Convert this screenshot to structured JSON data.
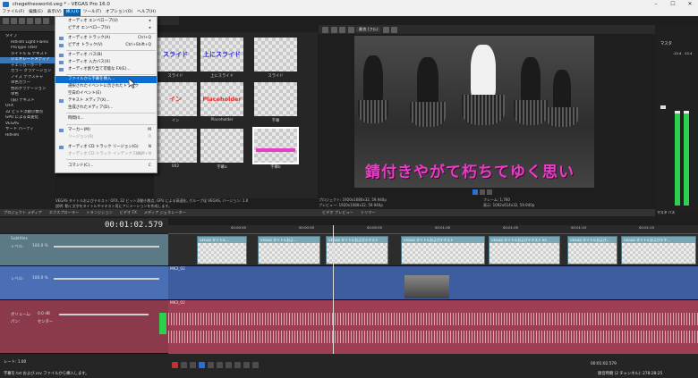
{
  "window": {
    "title": "chegethesworld.veg * - VEGAS Pro 16.0",
    "min": "–",
    "max": "☐",
    "close": "✕"
  },
  "menubar": [
    "ファイル(F)",
    "編集(E)",
    "表示(V)",
    "挿入(I)",
    "ツール(T)",
    "オプション(O)",
    "ヘルプ(H)"
  ],
  "menu_active": "挿入(I)",
  "insert_menu": [
    {
      "label": "オーディオ エンベロープ(U)",
      "shortcut": "",
      "state": "normal"
    },
    {
      "label": "ビデオ エンベロープ(V)",
      "shortcut": "",
      "state": "normal"
    },
    {
      "label": "オーディオ トラック(A)",
      "shortcut": "Ctrl+Q",
      "state": "normal"
    },
    {
      "label": "ビデオ トラック(V)",
      "shortcut": "Ctrl+Shift+Q",
      "state": "normal"
    },
    {
      "label": "オーディオ バス(B)",
      "shortcut": "",
      "state": "normal"
    },
    {
      "label": "オーディオ 入力バス(X)",
      "shortcut": "",
      "state": "normal"
    },
    {
      "label": "オーディオ割り当て可能な FX(E)...",
      "shortcut": "",
      "state": "normal"
    },
    {
      "label": "ファイルから字幕を挿入...",
      "shortcut": "",
      "state": "highlight"
    },
    {
      "label": "選択されたイベントに示されたトラック",
      "shortcut": "",
      "state": "normal"
    },
    {
      "label": "空白のイベント(E)",
      "shortcut": "",
      "state": "normal"
    },
    {
      "label": "テキスト メディア(X)...",
      "shortcut": "",
      "state": "normal"
    },
    {
      "label": "生成されたメディア(D)...",
      "shortcut": "",
      "state": "normal"
    },
    {
      "label": "時間(I)...",
      "shortcut": "",
      "state": "normal"
    },
    {
      "label": "マーカー(M)",
      "shortcut": "M",
      "state": "normal"
    },
    {
      "label": "リージョン(R)",
      "shortcut": "R",
      "state": "disabled"
    },
    {
      "label": "オーディオ CD トラック リージョン(G)",
      "shortcut": "N",
      "state": "normal"
    },
    {
      "label": "オーディオ CD トラック インデックス(X)",
      "shortcut": "Shift+N",
      "state": "disabled"
    },
    {
      "label": "コマンド(C)...",
      "shortcut": "C",
      "state": "normal"
    }
  ],
  "tree": [
    {
      "label": "タイプ",
      "level": 0
    },
    {
      "label": "HitFilm Light Flares",
      "level": 1
    },
    {
      "label": "ProType Titler",
      "level": 1
    },
    {
      "label": "タイトル & テキスト",
      "level": 1
    },
    {
      "label": "ジェネレートメディア",
      "level": 1,
      "selected": true
    },
    {
      "label": "チェッカーボード",
      "level": 1
    },
    {
      "label": "カラー グラデーション",
      "level": 1
    },
    {
      "label": "ノイズ テクスチャ",
      "level": 1
    },
    {
      "label": "単色カラー",
      "level": 1
    },
    {
      "label": "色のグラデーション",
      "level": 1
    },
    {
      "label": "単色",
      "level": 1
    },
    {
      "label": "(旧) テキスト",
      "level": 1
    },
    {
      "label": "OFX",
      "level": 0
    },
    {
      "label": "32 ビット浮動小数点",
      "level": 0
    },
    {
      "label": "GPU による高速化",
      "level": 0
    },
    {
      "label": "VEGAS",
      "level": 0
    },
    {
      "label": "サード パーティ",
      "level": 0
    },
    {
      "label": "HitFilm",
      "level": 0
    }
  ],
  "fx_thumbs": [
    {
      "text": "スライド",
      "label": "スライド",
      "color": "#2a2ae0"
    },
    {
      "text": "上にスライド",
      "label": "上にスライド",
      "color": "#2a2ae0"
    },
    {
      "text": "",
      "label": "スライド",
      "color": "#2a2ae0"
    },
    {
      "text": "イン",
      "label": "イン",
      "color": "#e03030"
    },
    {
      "text": "Placeholder",
      "label": "Placeholder",
      "color": "#e03030"
    },
    {
      "text": "",
      "label": "字幕",
      "color": "#222"
    },
    {
      "text": "",
      "label": "002",
      "color": "#222"
    },
    {
      "text": "",
      "label": "字幕a",
      "color": "#222"
    },
    {
      "text": "",
      "label": "字幕b",
      "color": "#e63fc7"
    }
  ],
  "fx_status": "VEGAS タイトルおよびテキスト: OFX, 32 ビット浮動小数点, GPU による高速化, グループ化 VEGAS, バージョン: 1.0",
  "fx_status2": "説明: 動く文字をタイトルやテキスト用にアニメーションを作成します。",
  "left_tabs": [
    "プロジェクト メディア",
    "エクスプローラー",
    "トランジション",
    "ビデオ FX",
    "メディア ジェネレーター"
  ],
  "preview": {
    "subtitle": "錆付きやがて朽ちてゆく思い",
    "project": "プロジェクト:  1920x1080x32, 59.940p",
    "preview_res": "プレビュー:  1920x1080x32, 59.940p",
    "frame_label": "フレーム:",
    "frame": "1,760",
    "display_label": "表示:",
    "display": "1092x614x32, 59.940p",
    "tabs": [
      "ビデオ プレビュー",
      "トリマー"
    ],
    "quality": "最良 (フル)"
  },
  "meter": {
    "title": "マスタ",
    "tab": "マスタ バス",
    "values": [
      "-12.4",
      "-12.4"
    ]
  },
  "timeline": {
    "timecode": "00:01:02.579",
    "ruler": [
      "00:00:45",
      "00:00:50",
      "00:00:55",
      "00:01:00",
      "00:01:05",
      "00:01:10",
      "00:01:15",
      "00:01:20",
      "00:01:25"
    ],
    "tracks": [
      {
        "name": "Subtitles",
        "level_label": "レベル:",
        "level": "100.0 %"
      },
      {
        "name": "",
        "level_label": "レベル:",
        "level": "100.0 %"
      },
      {
        "name": "",
        "volume_label": "ボリューム:",
        "volume": "0.0 dB",
        "pan_label": "パン:",
        "pan": "センター"
      }
    ],
    "clips": [
      "VEGAS タイトル...",
      "VEGAS タイトルおよ...",
      "VEGAS タイトルおよびテキスト",
      "VEGAS タイトルおよびテキスト",
      "VEGAS タイトルおよびテキスト 65",
      "VEGAS タイトルおよび...",
      "VEGAS タイトルおよびテキ..."
    ],
    "video_clip": "MK3_02",
    "audio_clip": "MK3_02"
  },
  "bottom": {
    "rate": "レート: 1.00",
    "time": "00:01:02.579",
    "status": "字幕を.txt および.csv ファイルから挿入します。",
    "record_time": "録音時間 (2 チャンネル): 278:28:25"
  }
}
